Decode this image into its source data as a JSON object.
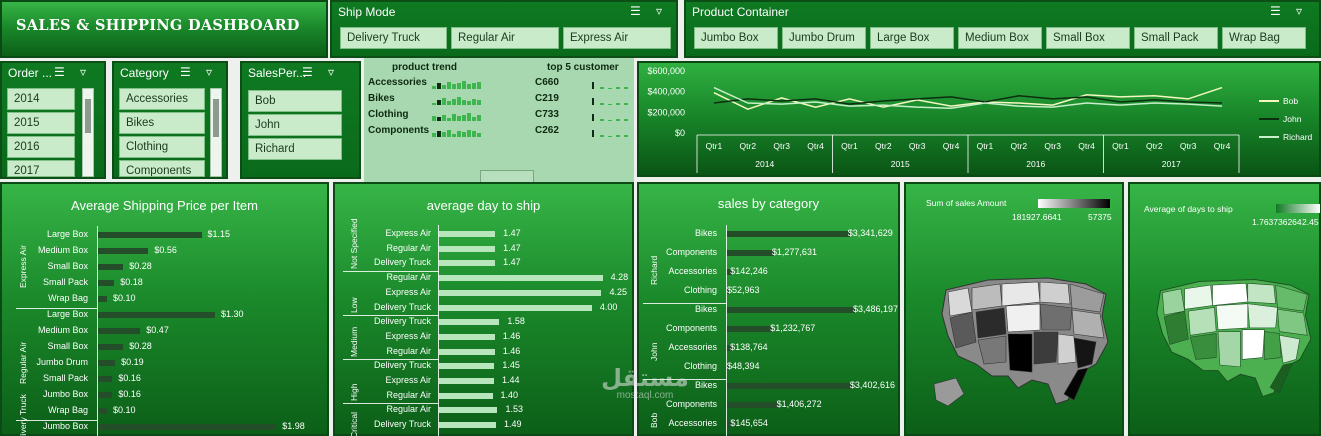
{
  "dashboard": {
    "title": "SALES & SHIPPING DASHBOARD"
  },
  "ship_mode": {
    "title": "Ship Mode",
    "items": [
      "Delivery Truck",
      "Regular Air",
      "Express Air"
    ]
  },
  "product_container": {
    "title": "Product Container",
    "items": [
      "Jumbo Box",
      "Jumbo Drum",
      "Large Box",
      "Medium Box",
      "Small Box",
      "Small Pack",
      "Wrap Bag"
    ]
  },
  "order_date": {
    "title": "Order ...",
    "items": [
      "2014",
      "2015",
      "2016",
      "2017"
    ]
  },
  "category": {
    "title": "Category",
    "items": [
      "Accessories",
      "Bikes",
      "Clothing",
      "Components"
    ]
  },
  "salesperson": {
    "title": "SalesPer...",
    "items": [
      "Bob",
      "John",
      "Richard"
    ]
  },
  "trend": {
    "title": "product trend",
    "products": [
      "Accessories",
      "Bikes",
      "Clothing",
      "Components"
    ],
    "customers_title": "top 5 customer",
    "customers": [
      "C660",
      "C219",
      "C733",
      "C262"
    ]
  },
  "line_chart": {
    "yticks": [
      "$600,000",
      "$400,000",
      "$200,000",
      "$0"
    ],
    "quarters": [
      "Qtr1",
      "Qtr2",
      "Qtr3",
      "Qtr4"
    ],
    "years": [
      "2014",
      "2015",
      "2016",
      "2017"
    ],
    "legend": [
      "Bob",
      "John",
      "Richard"
    ],
    "colors": {
      "Bob": "#f4f7c0",
      "John": "#0b2e10",
      "Richard": "#c7efc9"
    }
  },
  "chart_data": [
    {
      "type": "line",
      "x": [
        "2014 Qtr1",
        "2014 Qtr2",
        "2014 Qtr3",
        "2014 Qtr4",
        "2015 Qtr1",
        "2015 Qtr2",
        "2015 Qtr3",
        "2015 Qtr4",
        "2016 Qtr1",
        "2016 Qtr2",
        "2016 Qtr3",
        "2016 Qtr4",
        "2017 Qtr1",
        "2017 Qtr2",
        "2017 Qtr3",
        "2017 Qtr4"
      ],
      "series": [
        {
          "name": "Bob",
          "values": [
            390000,
            230000,
            340000,
            250000,
            330000,
            250000,
            320000,
            260000,
            300000,
            290000,
            270000,
            370000,
            350000,
            360000,
            330000,
            440000
          ]
        },
        {
          "name": "John",
          "values": [
            290000,
            330000,
            310000,
            330000,
            280000,
            310000,
            330000,
            350000,
            300000,
            360000,
            330000,
            350000,
            300000,
            320000,
            300000,
            290000
          ]
        },
        {
          "name": "Richard",
          "values": [
            440000,
            290000,
            280000,
            300000,
            260000,
            270000,
            250000,
            240000,
            290000,
            260000,
            250000,
            290000,
            270000,
            290000,
            280000,
            260000
          ]
        }
      ],
      "ylim": [
        0,
        600000
      ]
    },
    {
      "type": "bar",
      "title": "Average Shipping Price per Item",
      "groups": [
        {
          "name": "Express Air",
          "rows": [
            [
              "Large Box",
              1.15,
              "$1.15"
            ],
            [
              "Medium Box",
              0.56,
              "$0.56"
            ],
            [
              "Small Box",
              0.28,
              "$0.28"
            ],
            [
              "Small Pack",
              0.18,
              "$0.18"
            ],
            [
              "Wrap Bag",
              0.1,
              "$0.10"
            ]
          ]
        },
        {
          "name": "Regular Air",
          "rows": [
            [
              "Large Box",
              1.3,
              "$1.30"
            ],
            [
              "Medium Box",
              0.47,
              "$0.47"
            ],
            [
              "Small Box",
              0.28,
              "$0.28"
            ],
            [
              "Jumbo Drum",
              0.19,
              "$0.19"
            ],
            [
              "Small Pack",
              0.16,
              "$0.16"
            ],
            [
              "Jumbo Box",
              0.16,
              "$0.16"
            ],
            [
              "Wrap Bag",
              0.1,
              "$0.10"
            ]
          ]
        },
        {
          "name": "Delivery Truck",
          "rows": [
            [
              "Jumbo Box",
              1.98,
              "$1.98"
            ]
          ]
        }
      ],
      "max": 2.0
    },
    {
      "type": "bar",
      "title": "average day to ship",
      "groups": [
        {
          "name": "Not Specified",
          "rows": [
            [
              "Express Air",
              1.47,
              "1.47"
            ],
            [
              "Regular Air",
              1.47,
              "1.47"
            ],
            [
              "Delivery Truck",
              1.47,
              "1.47"
            ]
          ]
        },
        {
          "name": "Low",
          "rows": [
            [
              "Regular Air",
              4.28,
              "4.28"
            ],
            [
              "Express Air",
              4.25,
              "4.25"
            ],
            [
              "Delivery Truck",
              4.0,
              "4.00"
            ]
          ]
        },
        {
          "name": "Medium",
          "rows": [
            [
              "Delivery Truck",
              1.58,
              "1.58"
            ],
            [
              "Express Air",
              1.46,
              "1.46"
            ],
            [
              "Regular Air",
              1.46,
              "1.46"
            ]
          ]
        },
        {
          "name": "High",
          "rows": [
            [
              "Delivery Truck",
              1.45,
              "1.45"
            ],
            [
              "Express Air",
              1.44,
              "1.44"
            ],
            [
              "Regular Air",
              1.4,
              "1.40"
            ]
          ]
        },
        {
          "name": "Critical",
          "rows": [
            [
              "Regular Air",
              1.53,
              "1.53"
            ],
            [
              "Delivery Truck",
              1.49,
              "1.49"
            ]
          ]
        }
      ],
      "max": 4.5
    },
    {
      "type": "bar",
      "title": "sales by category",
      "groups": [
        {
          "name": "Richard",
          "rows": [
            [
              "Bikes",
              3341629,
              "$3,341,629"
            ],
            [
              "Components",
              1277631,
              "$1,277,631"
            ],
            [
              "Accessories",
              142246,
              "$142,246"
            ],
            [
              "Clothing",
              52963,
              "$52,963"
            ]
          ]
        },
        {
          "name": "John",
          "rows": [
            [
              "Bikes",
              3486197,
              "$3,486,197"
            ],
            [
              "Components",
              1232767,
              "$1,232,767"
            ],
            [
              "Accessories",
              138764,
              "$138,764"
            ],
            [
              "Clothing",
              48394,
              "$48,394"
            ]
          ]
        },
        {
          "name": "Bob",
          "rows": [
            [
              "Bikes",
              3402616,
              "$3,402,616"
            ],
            [
              "Components",
              1406272,
              "$1,406,272"
            ],
            [
              "Accessories",
              145654,
              "$145,654"
            ]
          ]
        }
      ],
      "max": 3486197
    }
  ],
  "map1": {
    "title": "Sum of sales Amount",
    "min": "181927.6641",
    "max": "57375"
  },
  "map2": {
    "title": "Average of days to ship",
    "min": "1.763736264",
    "max": "2.45"
  },
  "watermark": {
    "text": "مستقل",
    "sub": "mostaql.com"
  }
}
